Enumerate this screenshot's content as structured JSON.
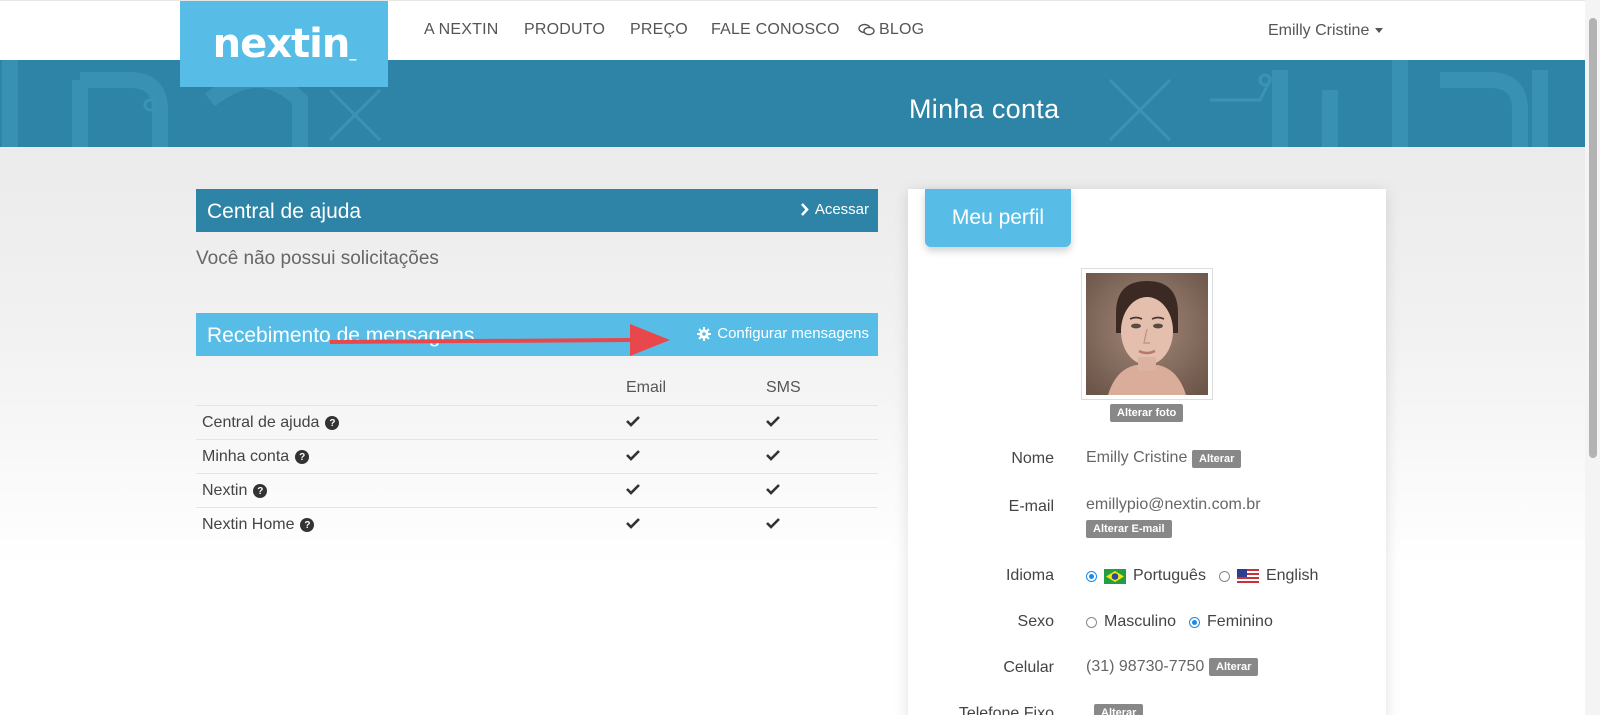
{
  "brand": {
    "logo": "nextin"
  },
  "nav": {
    "items": [
      {
        "label": "A NEXTIN"
      },
      {
        "label": "PRODUTO"
      },
      {
        "label": "PREÇO"
      },
      {
        "label": "FALE CONOSCO"
      },
      {
        "label": "BLOG",
        "icon": "chat-icon"
      }
    ],
    "user": "Emilly Cristine"
  },
  "banner": {
    "title": "Minha conta"
  },
  "help_center": {
    "title": "Central de ajuda",
    "action": "Acessar",
    "empty_text": "Você não possui solicitações"
  },
  "messages": {
    "title": "Recebimento de mensagens",
    "action": "Configurar mensagens",
    "columns": [
      "Email",
      "SMS"
    ],
    "rows": [
      {
        "label": "Central de ajuda",
        "email": true,
        "sms": true
      },
      {
        "label": "Minha conta",
        "email": true,
        "sms": true
      },
      {
        "label": "Nextin",
        "email": true,
        "sms": true
      },
      {
        "label": "Nextin Home",
        "email": true,
        "sms": true
      }
    ]
  },
  "profile": {
    "tab": "Meu perfil",
    "change_photo": "Alterar foto",
    "name_label": "Nome",
    "name": "Emilly Cristine",
    "email_label": "E-mail",
    "email": "emillypio@nextin.com.br",
    "change": "Alterar",
    "change_email": "Alterar E-mail",
    "language_label": "Idioma",
    "language_options": [
      "Português",
      "English"
    ],
    "language_selected": "Português",
    "sex_label": "Sexo",
    "sex_options": [
      "Masculino",
      "Feminino"
    ],
    "sex_selected": "Feminino",
    "phone_label": "Celular",
    "phone": "(31) 98730-7750",
    "landline_label": "Telefone Fixo"
  },
  "colors": {
    "primary_dark": "#2e84a6",
    "primary_light": "#58bde6",
    "arrow": "#e8474b"
  }
}
